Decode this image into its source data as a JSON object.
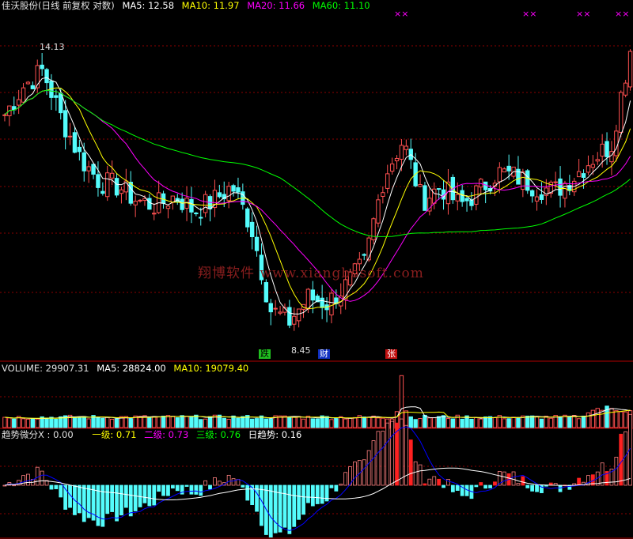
{
  "header": {
    "title": "佳沃股份(日线 前复权 对数)",
    "ma5": "MA5: 12.58",
    "ma10": "MA10: 11.97",
    "ma20": "MA20: 11.66",
    "ma60": "MA60: 11.10"
  },
  "volume_header": {
    "label": "VOLUME: 29907.31",
    "ma5": "MA5: 28824.00",
    "ma10": "MA10: 19079.40"
  },
  "indicator_header": {
    "label": "趋势微分X : 0.00",
    "level1": "一级: 0.71",
    "level2": "二级: 0.73",
    "level3": "三级: 0.76",
    "daily": "日趋势: 0.16"
  },
  "annotations": {
    "high_label": "14.13",
    "low_label": "8.45",
    "event_fall": "跌",
    "event_finance": "财",
    "event_rise": "张",
    "top_marker": "××"
  },
  "watermark": "翔博软件 www.xiangbosoft.com",
  "colors": {
    "up": "#ff5050",
    "down": "#54fcfc",
    "ma5": "#ffffff",
    "ma10": "#ffff00",
    "ma20": "#ff00ff",
    "ma60": "#00ff00",
    "grid": "#8b0000",
    "level1": "#ffff00",
    "level2": "#ff00ff",
    "level3": "#00ff00",
    "daily": "#ffffff",
    "trend_line": "#0000ff"
  },
  "chart_data": [
    {
      "type": "candlestick",
      "title": "佳沃股份(日线 前复权 对数)",
      "scale": "log",
      "ylim": [
        8.2,
        15.6
      ],
      "high": 14.13,
      "low": 8.45,
      "key_closes": [
        12.9,
        13.6,
        14.0,
        12.8,
        11.9,
        11.4,
        11.3,
        11.0,
        10.9,
        11.1,
        10.8,
        11.0,
        11.3,
        10.5,
        9.0,
        8.8,
        9.2,
        9.1,
        9.4,
        9.8,
        11.5,
        12.3,
        11.0,
        11.3,
        10.9,
        11.2,
        11.6,
        11.5,
        11.3,
        11.2,
        11.5,
        11.9,
        12.2,
        14.5
      ],
      "moving_averages": {
        "MA5": 12.58,
        "MA10": 11.97,
        "MA20": 11.66,
        "MA60": 11.1
      }
    },
    {
      "type": "bar",
      "title": "VOLUME",
      "latest": 29907.31,
      "MA5": 28824.0,
      "MA10": 19079.4
    },
    {
      "type": "area",
      "title": "趋势微分X",
      "values": {
        "X": 0.0,
        "一级": 0.71,
        "二级": 0.73,
        "三级": 0.76,
        "日趋势": 0.16
      }
    }
  ]
}
